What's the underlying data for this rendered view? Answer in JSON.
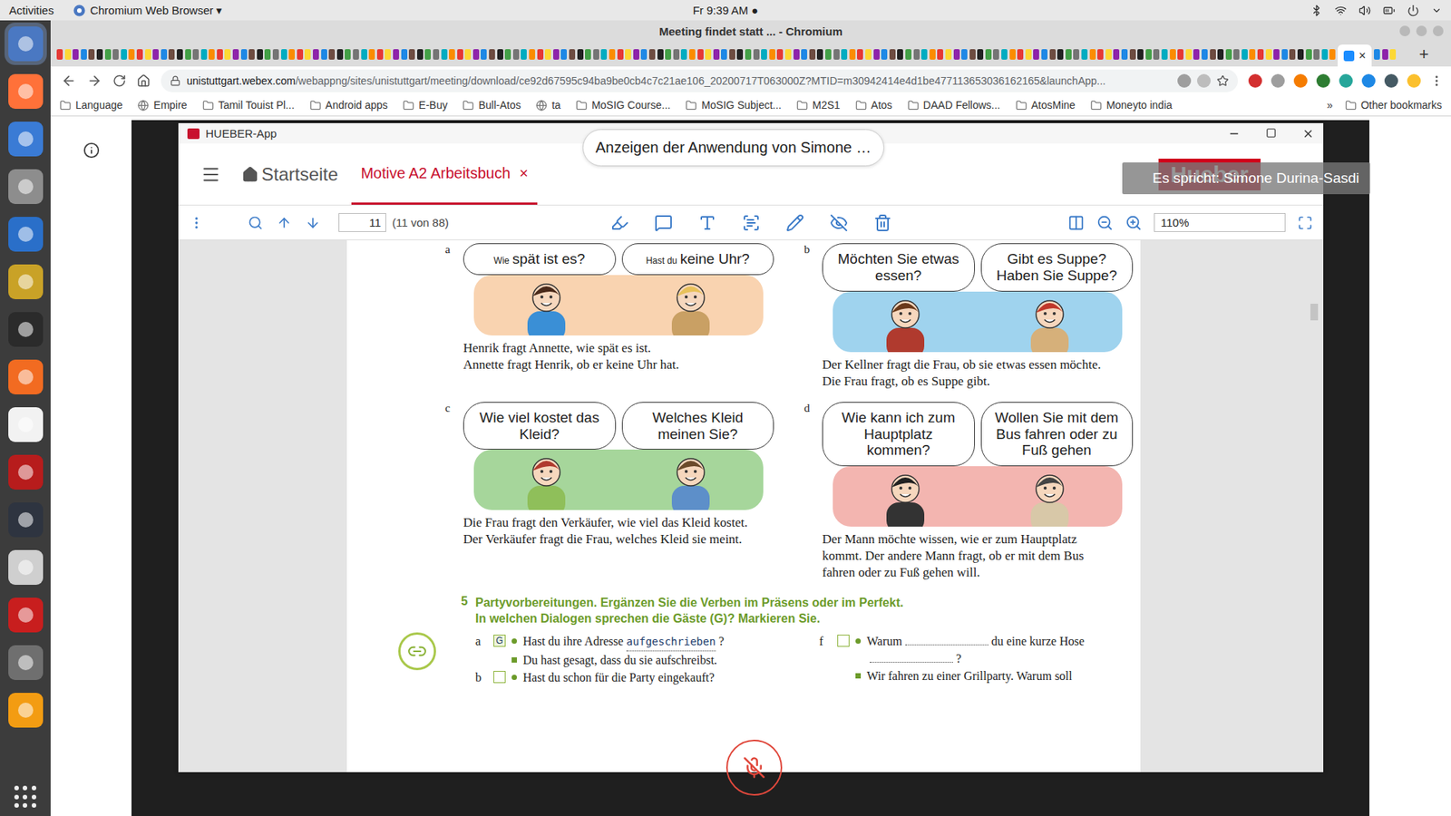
{
  "topbar": {
    "activities": "Activities",
    "app_menu": "Chromium Web Browser ▾",
    "clock": "Fr  9:39 AM ●"
  },
  "browser": {
    "title": "Meeting findet statt ... - Chromium",
    "tab_close": "×",
    "new_tab": "+",
    "url_host": "unistuttgart.webex.com",
    "url_rest": "/webappng/sites/unistuttgart/meeting/download/ce92d67595c94ba9be0cb4c7c21ae106_20200717T063000Z?MTID=m30942414e4d1be477113653036162165&launchApp...",
    "bookmarks": [
      {
        "label": "Language",
        "kind": "folder"
      },
      {
        "label": "Empire",
        "kind": "site"
      },
      {
        "label": "Tamil Touist Pl...",
        "kind": "folder"
      },
      {
        "label": "Android apps",
        "kind": "folder"
      },
      {
        "label": "E-Buy",
        "kind": "folder"
      },
      {
        "label": "Bull-Atos",
        "kind": "folder"
      },
      {
        "label": "ta",
        "kind": "site"
      },
      {
        "label": "MoSIG Course...",
        "kind": "folder"
      },
      {
        "label": "MoSIG Subject...",
        "kind": "folder"
      },
      {
        "label": "M2S1",
        "kind": "folder"
      },
      {
        "label": "Atos",
        "kind": "folder"
      },
      {
        "label": "DAAD Fellows...",
        "kind": "folder"
      },
      {
        "label": "AtosMine",
        "kind": "folder"
      },
      {
        "label": "Moneyto india",
        "kind": "folder"
      }
    ],
    "bookmarks_overflow": "»",
    "other_bookmarks": "Other bookmarks"
  },
  "meeting": {
    "share_banner": "Anzeigen der Anwendung von Simone …",
    "speaker": "Es spricht: Simone Durina-Sasdi",
    "mic_muted": true
  },
  "app": {
    "title": "HUEBER-App",
    "home": "Startseite",
    "tabs": [
      {
        "label": "Motive A2 Arbeitsbuch",
        "close": "×",
        "selected": true
      }
    ],
    "logo": "Hueber"
  },
  "pdf_toolbar": {
    "page": "11",
    "page_count": "(11 von 88)",
    "zoom": "110%"
  },
  "scrollbar": {
    "level": 0.12
  },
  "exercise4": {
    "panels": [
      {
        "letter": "a",
        "color": "#f9d3b0",
        "bubbles": [
          {
            "prefix": "Wie",
            "text": "spät ist es?"
          },
          {
            "prefix": "Hast du",
            "text": "keine Uhr?"
          }
        ],
        "caption": [
          "Henrik fragt Annette, wie spät es ist.",
          "Annette fragt Henrik, ob er keine Uhr hat."
        ]
      },
      {
        "letter": "b",
        "color": "#9fd3ee",
        "bubbles": [
          {
            "prefix": "",
            "text": "Möchten Sie etwas essen?"
          },
          {
            "prefix": "",
            "text": "Gibt es Suppe? Haben Sie Suppe?"
          }
        ],
        "caption": [
          "Der Kellner fragt die Frau, ob sie etwas essen möchte.",
          "Die Frau fragt, ob es Suppe gibt."
        ]
      },
      {
        "letter": "c",
        "color": "#a6d69b",
        "bubbles": [
          {
            "prefix": "",
            "text": "Wie viel kostet das Kleid?"
          },
          {
            "prefix": "",
            "text": "Welches Kleid meinen Sie?"
          }
        ],
        "caption": [
          "Die Frau fragt den Verkäufer, wie viel das Kleid kostet.",
          "Der Verkäufer fragt die Frau, welches Kleid sie meint."
        ]
      },
      {
        "letter": "d",
        "color": "#f3b5b0",
        "bubbles": [
          {
            "prefix": "",
            "text": "Wie kann ich zum Hauptplatz kommen?"
          },
          {
            "prefix": "",
            "text": "Wollen Sie mit dem Bus fahren oder zu Fuß gehen"
          }
        ],
        "caption": [
          "Der Mann möchte wissen, wie er zum Hauptplatz",
          "kommt. Der andere Mann fragt, ob er mit dem Bus",
          "fahren oder zu Fuß gehen will."
        ]
      }
    ]
  },
  "exercise5": {
    "number": "5",
    "instructions": [
      "Partyvorbereitungen. Ergänzen Sie die Verben im Präsens oder im Perfekt.",
      "In welchen Dialogen sprechen die Gäste (G)? Markieren Sie."
    ],
    "columns": [
      [
        {
          "letter": "a",
          "mark": "G",
          "marked": true,
          "lines": [
            {
              "bullet": "dot",
              "segments": [
                {
                  "text": "Hast du ihre Adresse"
                },
                {
                  "blank": "aufgeschrieben"
                },
                {
                  "text": "?"
                }
              ]
            },
            {
              "bullet": "square",
              "segments": [
                {
                  "text": "Du hast gesagt, dass du sie aufschreibst."
                }
              ]
            }
          ]
        },
        {
          "letter": "b",
          "mark": "",
          "marked": false,
          "lines": [
            {
              "bullet": "dot",
              "segments": [
                {
                  "text": "Hast du schon für die Party eingekauft?"
                }
              ]
            }
          ]
        }
      ],
      [
        {
          "letter": "f",
          "mark": "",
          "marked": false,
          "lines": [
            {
              "bullet": "dot",
              "segments": [
                {
                  "text": "Warum"
                },
                {
                  "blank": ""
                },
                {
                  "text": "du eine kurze Hose"
                },
                {
                  "blank": ""
                },
                {
                  "text": "?"
                }
              ]
            },
            {
              "bullet": "square",
              "segments": [
                {
                  "text": "Wir fahren zu einer Grillparty. Warum soll"
                }
              ]
            }
          ]
        }
      ]
    ]
  }
}
